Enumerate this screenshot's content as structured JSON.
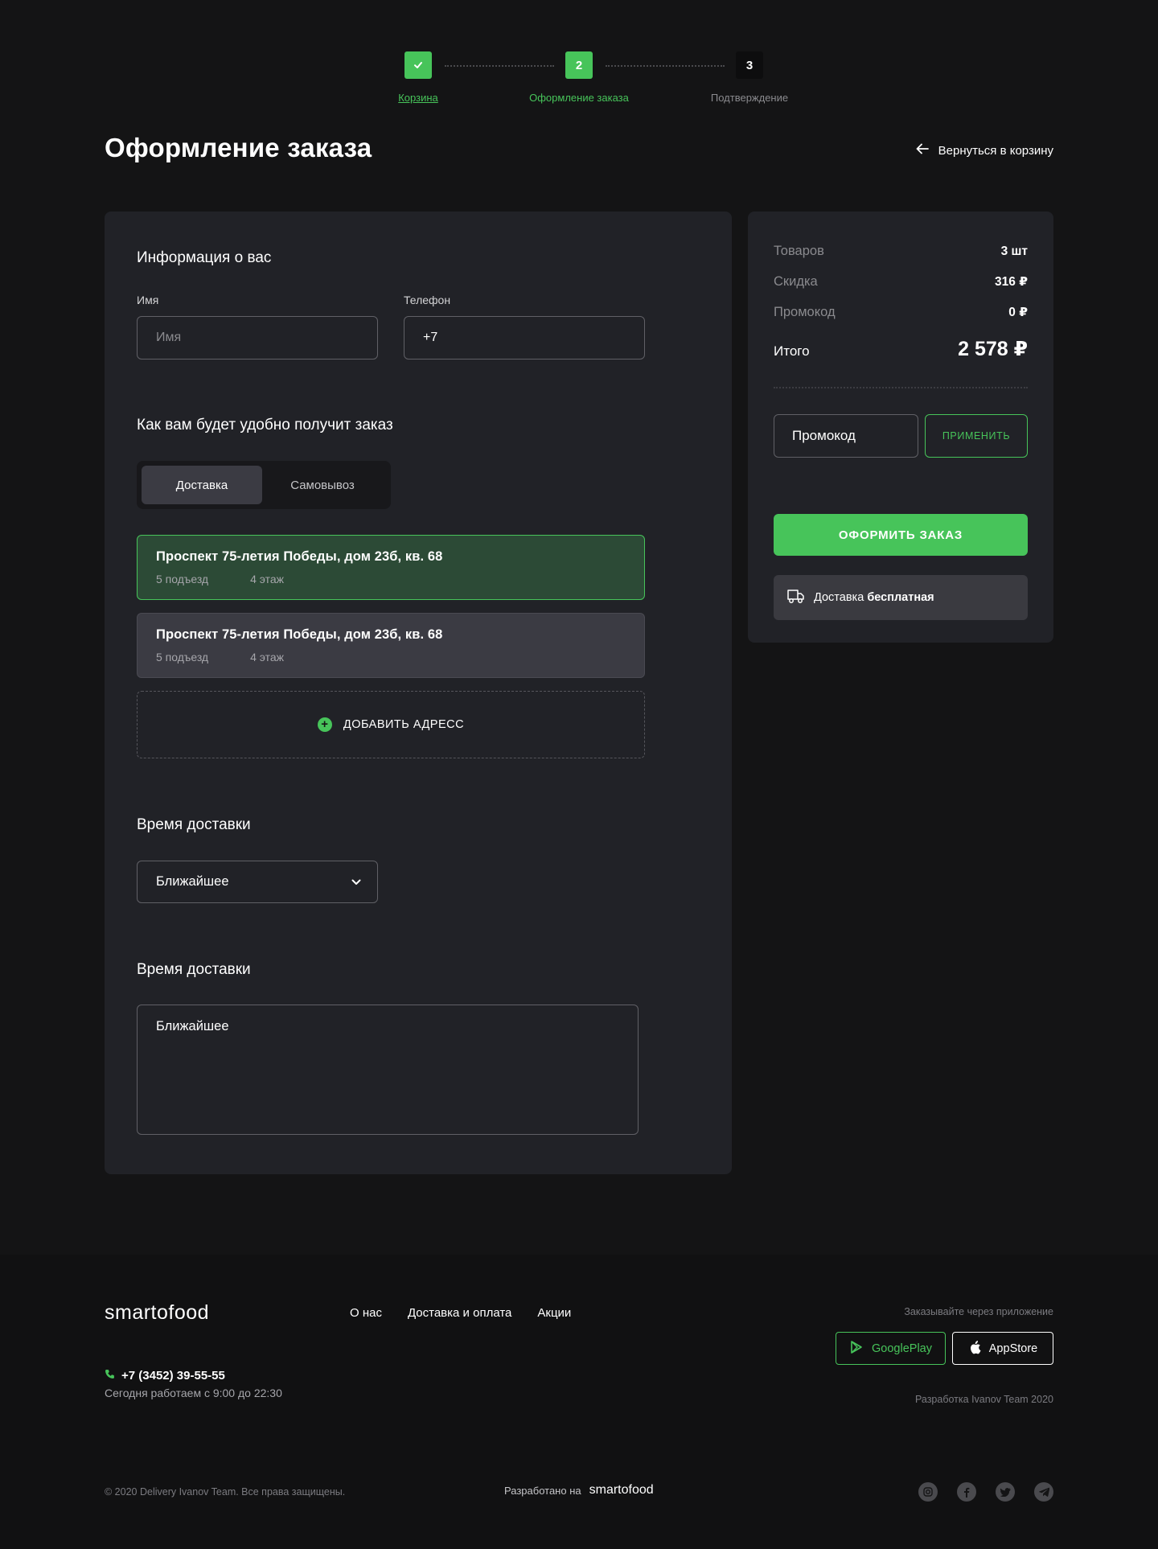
{
  "stepper": {
    "steps": [
      {
        "number": "",
        "label": "Корзина",
        "state": "done"
      },
      {
        "number": "2",
        "label": "Оформление заказа",
        "state": "active"
      },
      {
        "number": "3",
        "label": "Подтверждение",
        "state": "pending"
      }
    ]
  },
  "header": {
    "title": "Оформление заказа",
    "back_label": "Вернуться в корзину"
  },
  "info": {
    "title": "Информация о вас",
    "name_label": "Имя",
    "name_placeholder": "Имя",
    "phone_label": "Телефон",
    "phone_value": "+7"
  },
  "receive": {
    "title": "Как вам будет удобно получит заказ",
    "options": [
      "Доставка",
      "Самовывоз"
    ],
    "selected": "Доставка"
  },
  "addresses": [
    {
      "title": "Проспект 75-летия Победы, дом 23б, кв. 68",
      "entrance": "5 подъезд",
      "floor": "4 этаж",
      "selected": true
    },
    {
      "title": "Проспект 75-летия Победы, дом 23б, кв. 68",
      "entrance": "5 подъезд",
      "floor": "4 этаж",
      "selected": false
    }
  ],
  "add_address_label": "ДОБАВИТЬ АДРЕСС",
  "delivery_time": {
    "title": "Время доставки",
    "selected": "Ближайшее"
  },
  "delivery_time2": {
    "title": "Время доставки",
    "value": "Ближайшее"
  },
  "summary": {
    "items_label": "Товаров",
    "items_value": "3 шт",
    "discount_label": "Скидка",
    "discount_value": "316 ₽",
    "promo_label": "Промокод",
    "promo_value": "0 ₽",
    "total_label": "Итого",
    "total_value": "2 578 ₽",
    "promo_placeholder": "Промокод",
    "apply_label": "ПРИМЕНИТЬ",
    "order_label": "ОФОРМИТЬ ЗАКАЗ",
    "delivery_prefix": "Доставка",
    "delivery_bold": "бесплатная"
  },
  "footer": {
    "logo": "smartofood",
    "nav": [
      "О нас",
      "Доставка и оплата",
      "Акции"
    ],
    "app_caption": "Заказывайте через приложение",
    "google_play": "GooglePlay",
    "app_store": "AppStore",
    "dev_credit": "Разработка Ivanov Team 2020",
    "phone": "+7 (3452) 39-55-55",
    "hours": "Сегодня работаем с 9:00 до 22:30",
    "copyright": "© 2020 Delivery Ivanov Team. Все права защищены.",
    "made_by": "Разработано на",
    "made_by_logo": "smartofood"
  },
  "colors": {
    "accent": "#47c45a",
    "background": "#141415",
    "panel": "#212227"
  }
}
